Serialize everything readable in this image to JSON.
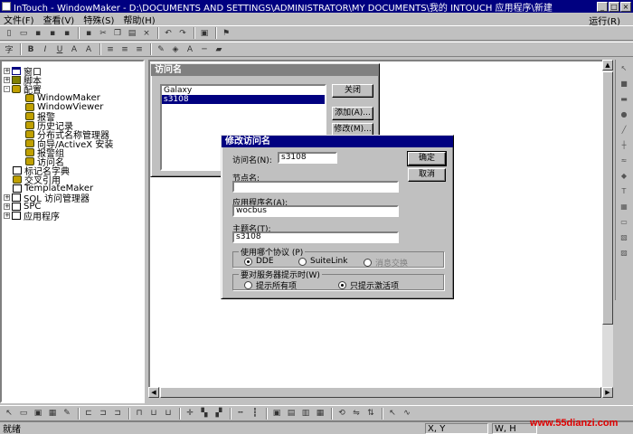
{
  "window": {
    "title": "InTouch - WindowMaker - D:\\DOCUMENTS AND SETTINGS\\ADMINISTRATOR\\MY DOCUMENTS\\我的 INTOUCH 应用程序\\新建"
  },
  "menu": {
    "items": [
      "文件(F)",
      "查看(V)",
      "特殊(S)",
      "帮助(H)"
    ],
    "right": "运行(R)"
  },
  "tree": {
    "items": [
      {
        "label": "窗口",
        "expand": "+",
        "icon": "window-icon"
      },
      {
        "label": "脚本",
        "expand": "+",
        "icon": "script-icon"
      },
      {
        "label": "配置",
        "expand": "-",
        "icon": "config-icon"
      },
      {
        "label": "WindowMaker",
        "icon": "key-icon"
      },
      {
        "label": "WindowViewer",
        "icon": "key-icon"
      },
      {
        "label": "报警",
        "icon": "key-icon"
      },
      {
        "label": "历史记录",
        "icon": "key-icon"
      },
      {
        "label": "分布式名称管理器",
        "icon": "key-icon"
      },
      {
        "label": "向导/ActiveX 安装",
        "icon": "key-icon"
      },
      {
        "label": "报警组",
        "icon": "key-icon"
      },
      {
        "label": "访问名",
        "icon": "access-icon"
      },
      {
        "label": "标记名字典",
        "icon": "dict-icon"
      },
      {
        "label": "交叉引用",
        "icon": "xref-icon"
      },
      {
        "label": "TemplateMaker",
        "icon": "template-icon"
      },
      {
        "label": "SQL 访问管理器",
        "expand": "+",
        "icon": "sql-icon"
      },
      {
        "label": "SPC",
        "expand": "+",
        "icon": "spc-icon"
      },
      {
        "label": "应用程序",
        "expand": "+",
        "icon": "app-icon"
      }
    ]
  },
  "access_names_dialog": {
    "title": "访问名",
    "list": [
      "Galaxy",
      "s3108"
    ],
    "selected_index": 1,
    "buttons": {
      "close": "关闭",
      "add": "添加(A)...",
      "modify": "修改(M)..."
    }
  },
  "modify_dialog": {
    "title": "修改访问名",
    "access_name_label": "访问名(N):",
    "access_name_value": "s3108",
    "node_label": "节点名:",
    "node_value": "",
    "app_label": "应用程序名(A):",
    "app_value": "wocbus",
    "topic_label": "主题名(T):",
    "topic_value": "s3108",
    "protocol_group": "使用哪个协议 (P)",
    "protocol_options": [
      "DDE",
      "SuiteLink",
      "消息交换"
    ],
    "protocol_selected": 0,
    "notify_group": "要对服务器提示时(W)",
    "notify_options": [
      "提示所有项",
      "只提示激活项"
    ],
    "notify_selected": 1,
    "ok_label": "确定",
    "cancel_label": "取消"
  },
  "status": {
    "ready": "就绪",
    "xy": "X, Y",
    "wh": "W, H"
  },
  "watermark": "www.55dianzi.com"
}
